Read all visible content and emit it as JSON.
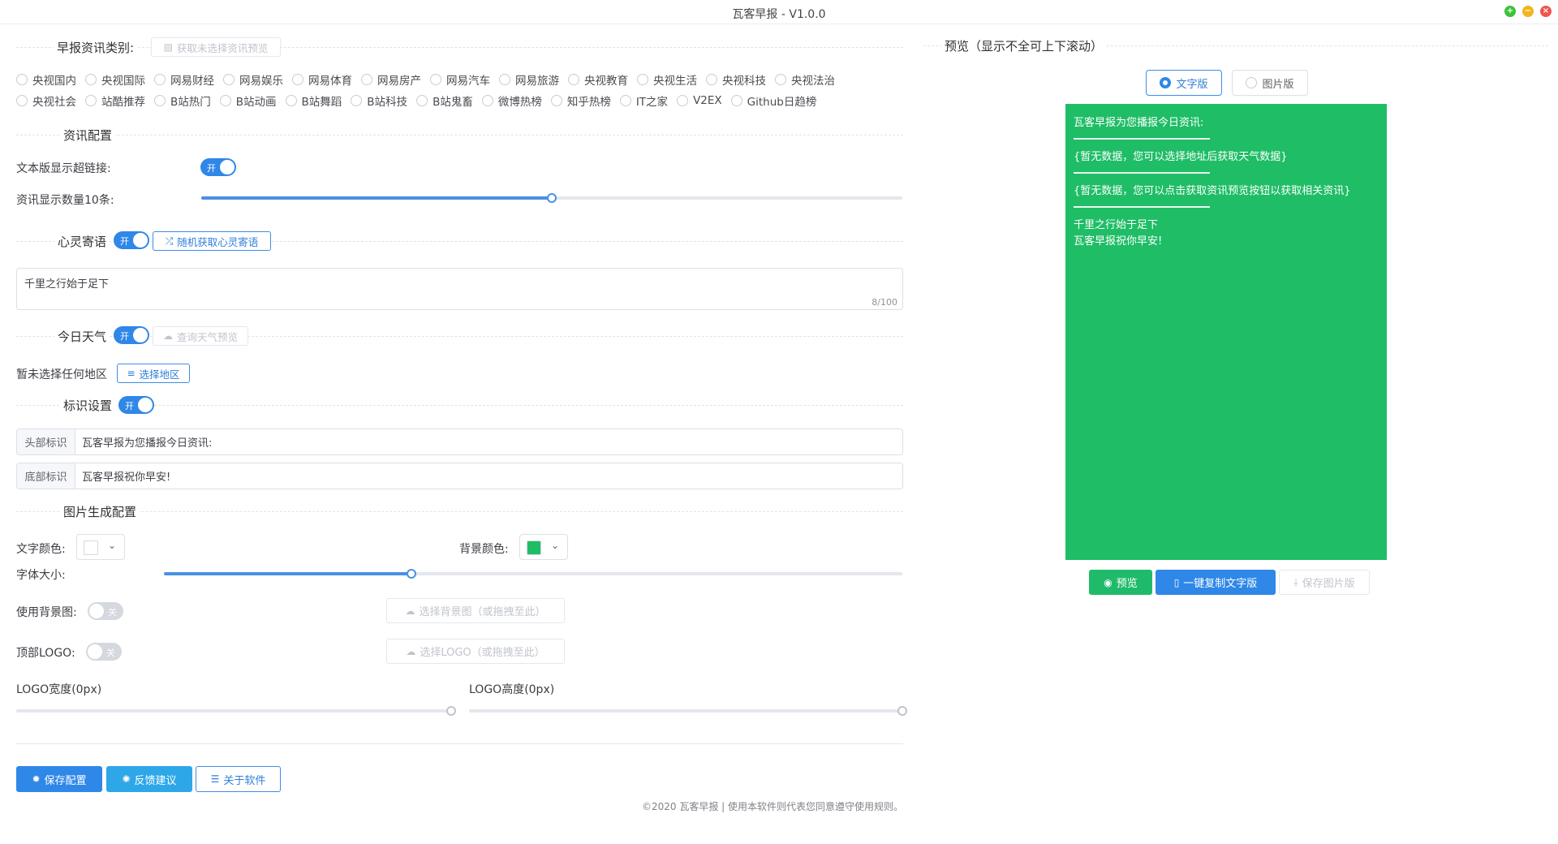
{
  "window": {
    "title": "瓦客早报 - V1.0.0"
  },
  "categories": {
    "label": "早报资讯类别:",
    "fetch_button": "获取未选择资讯预览",
    "row1": [
      "央视国内",
      "央视国际",
      "网易财经",
      "网易娱乐",
      "网易体育",
      "网易房产",
      "网易汽车",
      "网易旅游",
      "央视教育",
      "央视生活",
      "央视科技",
      "央视法治"
    ],
    "row2": [
      "央视社会",
      "站酷推荐",
      "B站热门",
      "B站动画",
      "B站舞蹈",
      "B站科技",
      "B站鬼畜",
      "微博热榜",
      "知乎热榜",
      "IT之家",
      "V2EX",
      "Github日趋榜"
    ]
  },
  "news_config": {
    "label": "资讯配置",
    "hyperlink_label": "文本版显示超链接:",
    "hyperlink_switch": "开",
    "count_label": "资讯显示数量10条:",
    "count_value": 10
  },
  "mind": {
    "label": "心灵寄语",
    "switch": "开",
    "random_button": "随机获取心灵寄语",
    "text": "千里之行始于足下",
    "count": "8/100"
  },
  "weather": {
    "label": "今日天气",
    "switch": "开",
    "query_button": "查询天气预览",
    "region_label": "暂未选择任何地区",
    "region_button": "选择地区"
  },
  "marker": {
    "label": "标识设置",
    "switch": "开",
    "header_prefix": "头部标识",
    "header_value": "瓦客早报为您播报今日资讯:",
    "footer_prefix": "底部标识",
    "footer_value": "瓦客早报祝你早安!"
  },
  "image_config": {
    "label": "图片生成配置",
    "text_color_label": "文字颜色:",
    "text_color": "#ffffff",
    "bg_color_label": "背景颜色:",
    "bg_color": "#1fbd66",
    "font_size_label": "字体大小:",
    "font_size_fraction": 0.335,
    "bg_image_label": "使用背景图:",
    "bg_image_switch": "关",
    "bg_image_button": "选择背景图（或拖拽至此）",
    "logo_label": "顶部LOGO:",
    "logo_switch": "关",
    "logo_button": "选择LOGO（或拖拽至此）",
    "logo_width_label": "LOGO宽度(0px)",
    "logo_height_label": "LOGO高度(0px)"
  },
  "actions": {
    "save": "保存配置",
    "feedback": "反馈建议",
    "about": "关于软件"
  },
  "copyright": "©2020 瓦客早报 | 使用本软件则代表您同意遵守使用规则。",
  "preview": {
    "label": "预览（显示不全可上下滚动）",
    "tab_text": "文字版",
    "tab_image": "图片版",
    "line_header": "瓦客早报为您播报今日资讯:",
    "line_weather": "{暂无数据，您可以选择地址后获取天气数据}",
    "line_news": "{暂无数据，您可以点击获取资讯预览按钮以获取相关资讯}",
    "line_mind": "千里之行始于足下",
    "line_footer": "瓦客早报祝你早安!",
    "btn_preview": "预览",
    "btn_copy": "一键复制文字版",
    "btn_save_image": "保存图片版"
  }
}
